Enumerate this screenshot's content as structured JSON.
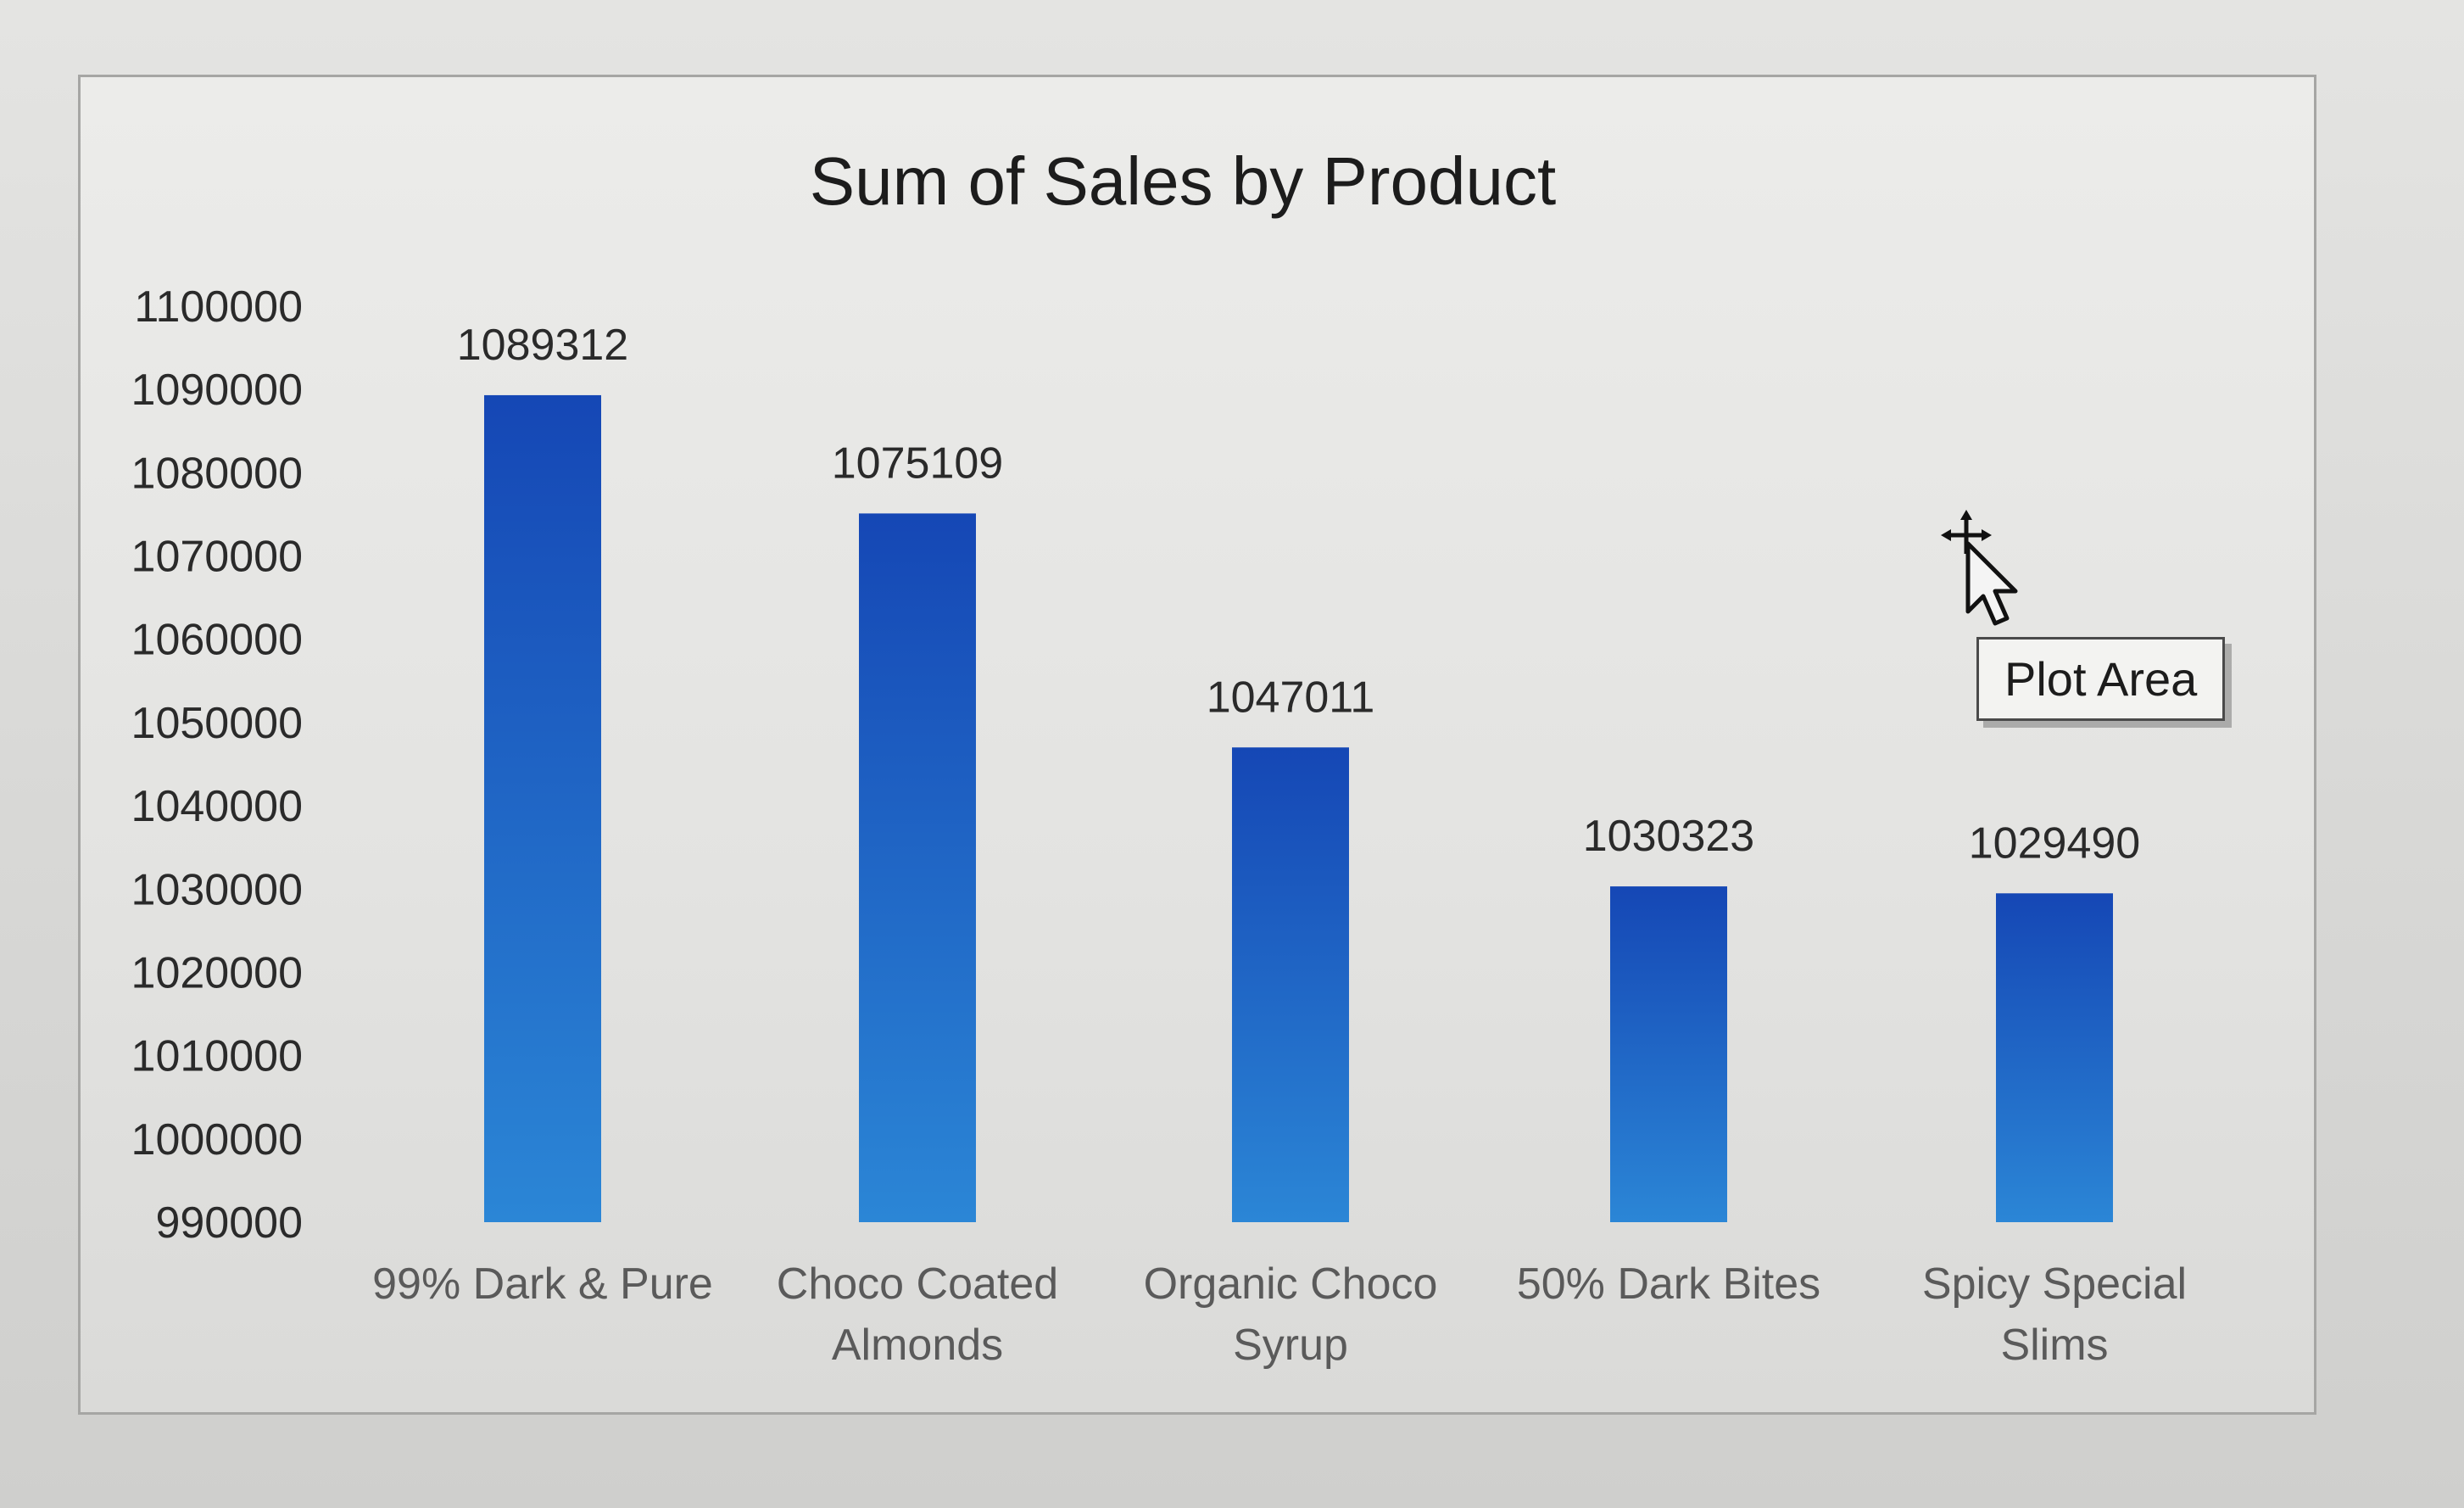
{
  "colors": {
    "bar_dark": "#1547b5",
    "bar_light": "#2b86d6"
  },
  "tooltip": {
    "text": "Plot Area"
  },
  "cursor": {
    "icon": "move-pointer-icon"
  },
  "chart_data": {
    "type": "bar",
    "title": "Sum of Sales by Product",
    "xlabel": "",
    "ylabel": "",
    "categories": [
      "99% Dark & Pure",
      "Choco Coated Almonds",
      "Organic Choco Syrup",
      "50% Dark Bites",
      "Spicy Special Slims"
    ],
    "category_lines": [
      [
        "99% Dark & Pure"
      ],
      [
        "Choco Coated",
        "Almonds"
      ],
      [
        "Organic Choco",
        "Syrup"
      ],
      [
        "50% Dark Bites"
      ],
      [
        "Spicy Special",
        "Slims"
      ]
    ],
    "values": [
      1089312,
      1075109,
      1047011,
      1030323,
      1029490
    ],
    "data_labels": [
      "1089312",
      "1075109",
      "1047011",
      "1030323",
      "1029490"
    ],
    "ylim": [
      990000,
      1100000
    ],
    "yticks": [
      "1100000",
      "1090000",
      "1080000",
      "1070000",
      "1060000",
      "1050000",
      "1040000",
      "1030000",
      "1020000",
      "1010000",
      "1000000",
      "990000"
    ],
    "grid": false,
    "legend": "none"
  }
}
